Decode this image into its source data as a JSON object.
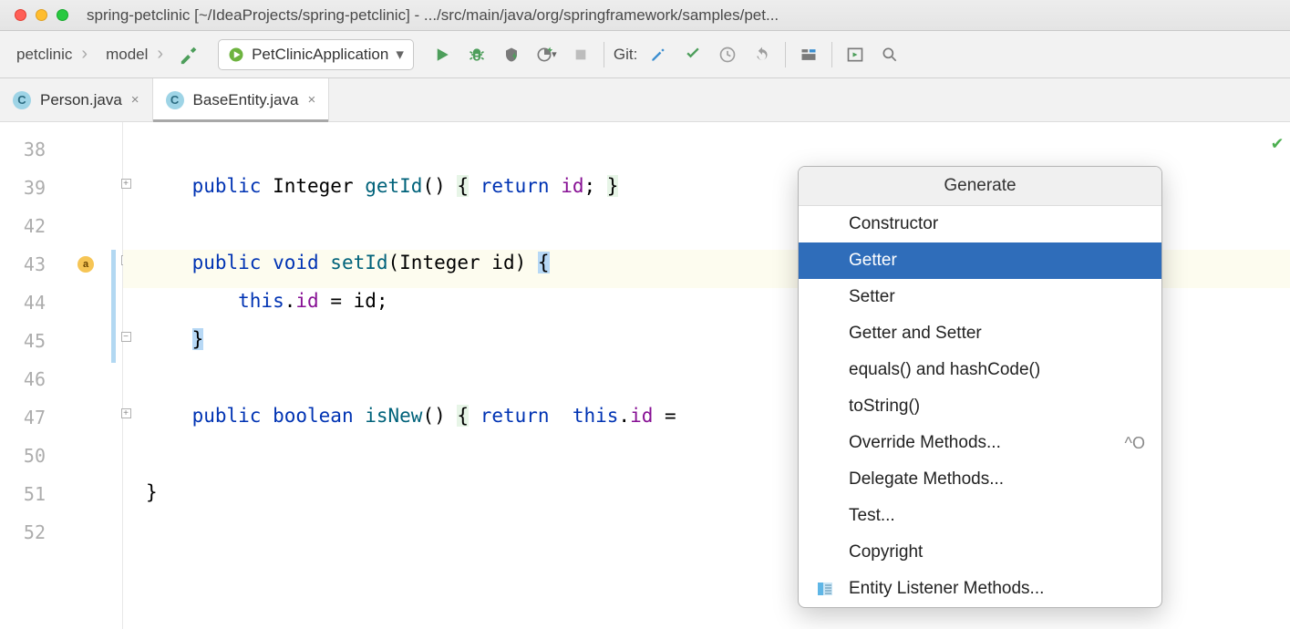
{
  "window": {
    "title": "spring-petclinic [~/IdeaProjects/spring-petclinic] - .../src/main/java/org/springframework/samples/pet..."
  },
  "breadcrumbs": [
    "petclinic",
    "model"
  ],
  "run_config": "PetClinicApplication",
  "git_label": "Git:",
  "tabs": [
    {
      "name": "Person.java",
      "active": false
    },
    {
      "name": "BaseEntity.java",
      "active": true
    }
  ],
  "line_numbers": [
    "38",
    "39",
    "42",
    "43",
    "44",
    "45",
    "46",
    "47",
    "50",
    "51",
    "52"
  ],
  "code": {
    "l39_kw": "public",
    "l39_type": " Integer ",
    "l39_method": "getId",
    "l39_rest1": "() ",
    "l39_brace1": "{",
    "l39_kw2": " return ",
    "l39_id": "id",
    "l39_rest2": "; ",
    "l39_brace2": "}",
    "l43_kw": "public",
    "l43_type": " void ",
    "l43_method": "setId",
    "l43_rest1": "(Integer id) ",
    "l43_brace": "{",
    "l44_this": "    this",
    "l44_dot": ".",
    "l44_id": "id",
    "l44_rest": " = id;",
    "l45_brace": "}",
    "l47_kw": "public",
    "l47_type": " boolean ",
    "l47_method": "isNew",
    "l47_rest1": "() ",
    "l47_brace1": "{",
    "l47_kw2": " return ",
    "l47_this": " this",
    "l47_dot": ".",
    "l47_id": "id",
    "l47_rest2": " =",
    "l51_brace": "}"
  },
  "popup": {
    "title": "Generate",
    "items": [
      {
        "label": "Constructor",
        "shortcut": ""
      },
      {
        "label": "Getter",
        "shortcut": "",
        "selected": true
      },
      {
        "label": "Setter",
        "shortcut": ""
      },
      {
        "label": "Getter and Setter",
        "shortcut": ""
      },
      {
        "label": "equals() and hashCode()",
        "shortcut": ""
      },
      {
        "label": "toString()",
        "shortcut": ""
      },
      {
        "label": "Override Methods...",
        "shortcut": "^O"
      },
      {
        "label": "Delegate Methods...",
        "shortcut": ""
      },
      {
        "label": "Test...",
        "shortcut": ""
      },
      {
        "label": "Copyright",
        "shortcut": ""
      },
      {
        "label": "Entity Listener Methods...",
        "shortcut": "",
        "icon": true
      }
    ]
  }
}
